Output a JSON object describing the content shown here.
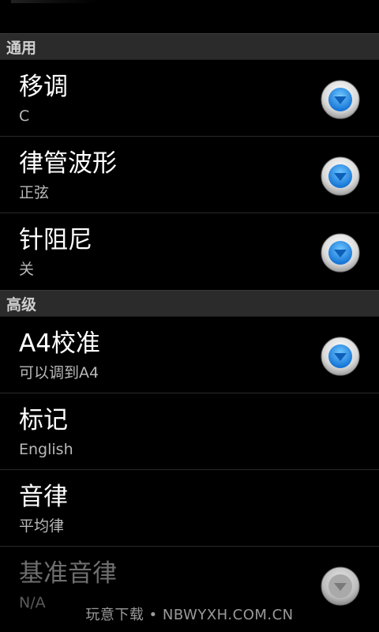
{
  "sections": [
    {
      "header": "通用",
      "items": [
        {
          "title": "移调",
          "summary": "C",
          "has_dropdown": true,
          "enabled": true
        },
        {
          "title": "律管波形",
          "summary": "正弦",
          "has_dropdown": true,
          "enabled": true
        },
        {
          "title": "针阻尼",
          "summary": "关",
          "has_dropdown": true,
          "enabled": true
        }
      ]
    },
    {
      "header": "高级",
      "items": [
        {
          "title": "A4校准",
          "summary": "可以调到A4",
          "has_dropdown": true,
          "enabled": true
        },
        {
          "title": "标记",
          "summary": "English",
          "has_dropdown": false,
          "enabled": true
        },
        {
          "title": "音律",
          "summary": "平均律",
          "has_dropdown": false,
          "enabled": true
        },
        {
          "title": "基准音律",
          "summary": "N/A",
          "has_dropdown": true,
          "enabled": false
        }
      ]
    }
  ],
  "watermark": "玩意下载 • NBWYXH.COM.CN",
  "icons": {
    "dropdown": "chevron-down-circle-icon"
  },
  "colors": {
    "background": "#000000",
    "section_header_bg": "#2b2b2b",
    "dropdown_arrow_active": "#1e90e8",
    "dropdown_arrow_disabled": "#8a8a8a"
  }
}
